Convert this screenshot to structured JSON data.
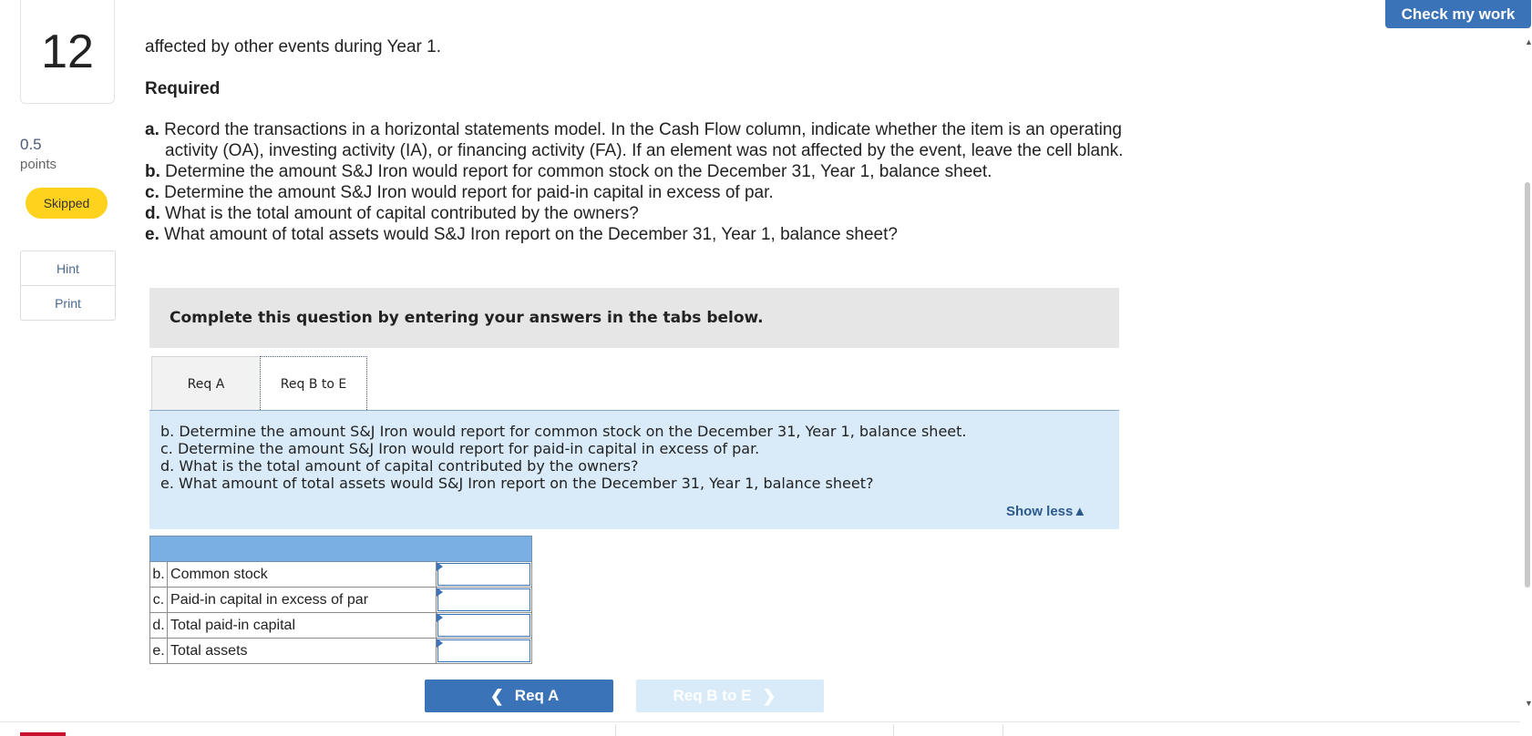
{
  "header": {
    "check_label": "Check my work"
  },
  "sidebar": {
    "question_number": "12",
    "points_value": "0.5",
    "points_label": "points",
    "status": "Skipped",
    "hint_label": "Hint",
    "print_label": "Print"
  },
  "question": {
    "intro": "affected by other events during Year 1.",
    "required_label": "Required",
    "items": [
      {
        "letter": "a.",
        "text": "Record the transactions in a horizontal statements model. In the Cash Flow column, indicate whether the item is an operating activity (OA), investing activity (IA), or financing activity (FA). If an element was not affected by the event, leave the cell blank."
      },
      {
        "letter": "b.",
        "text": "Determine the amount S&J Iron would report for common stock on the December 31, Year 1, balance sheet."
      },
      {
        "letter": "c.",
        "text": "Determine the amount S&J Iron would report for paid-in capital in excess of par."
      },
      {
        "letter": "d.",
        "text": "What is the total amount of capital contributed by the owners?"
      },
      {
        "letter": "e.",
        "text": "What amount of total assets would S&J Iron report on the December 31, Year 1, balance sheet?"
      }
    ]
  },
  "panel": {
    "instruction": "Complete this question by entering your answers in the tabs below."
  },
  "tabs": [
    {
      "label": "Req A"
    },
    {
      "label": "Req B to E"
    }
  ],
  "active_tab": {
    "lines": [
      "b. Determine the amount S&J Iron would report for common stock on the December 31, Year 1, balance sheet.",
      "c. Determine the amount S&J Iron would report for paid-in capital in excess of par.",
      "d. What is the total amount of capital contributed by the owners?",
      "e. What amount of total assets would S&J Iron report on the December 31, Year 1, balance sheet?"
    ],
    "show_less_label": "Show less"
  },
  "answer_table": {
    "rows": [
      {
        "letter": "b.",
        "label": "Common stock",
        "value": ""
      },
      {
        "letter": "c.",
        "label": "Paid-in capital in excess of par",
        "value": ""
      },
      {
        "letter": "d.",
        "label": "Total paid-in capital",
        "value": ""
      },
      {
        "letter": "e.",
        "label": "Total assets",
        "value": ""
      }
    ]
  },
  "nav": {
    "prev_label": "Req A",
    "next_label": "Req B to E"
  },
  "colors": {
    "accent": "#3a73b8",
    "skipped_badge": "#ffd21e",
    "panel_blue": "#d9ebf9",
    "table_header": "#7aafe4"
  },
  "icons": {
    "prev": "chevron-left-icon",
    "next": "chevron-right-icon",
    "show_less": "triangle-up-icon"
  }
}
